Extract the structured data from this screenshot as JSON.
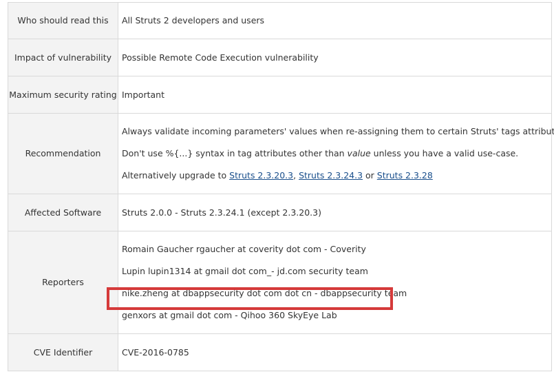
{
  "rows": [
    {
      "label": "Who should read this",
      "value": "All Struts 2 developers and users"
    },
    {
      "label": "Impact of vulnerability",
      "value": "Possible Remote Code Execution vulnerability"
    },
    {
      "label": "Maximum security rating",
      "value": "Important"
    },
    {
      "label": "Recommendation",
      "lines": {
        "l1": "Always validate incoming parameters' values when re-assigning them to certain Struts' tags attributes.",
        "l2_pre": "Don't use %{...} syntax in tag attributes other than ",
        "l2_em": "value",
        "l2_post": " unless you have a valid use-case.",
        "l3_pre": "Alternatively upgrade to ",
        "link1": "Struts 2.3.20.3",
        "sep1": ", ",
        "link2": "Struts 2.3.24.3",
        "sep2": " or ",
        "link3": "Struts 2.3.28"
      }
    },
    {
      "label": "Affected Software",
      "value": "Struts 2.0.0 - Struts 2.3.24.1 (except 2.3.20.3)"
    },
    {
      "label": "Reporters",
      "reporters": [
        "Romain Gaucher rgaucher at coverity dot com - Coverity",
        "Lupin lupin1314 at gmail dot com_- jd.com security team",
        "nike.zheng at dbappsecurity dot com dot cn - dbappsecurity team",
        "genxors at gmail dot com - Qihoo 360 SkyEye Lab"
      ]
    },
    {
      "label": "CVE Identifier",
      "value": "CVE-2016-0785"
    }
  ],
  "colors": {
    "label_bg": "#f3f3f3",
    "border": "#d9d9d9",
    "highlight": "#d53a3a",
    "link": "#1a4f8c"
  }
}
